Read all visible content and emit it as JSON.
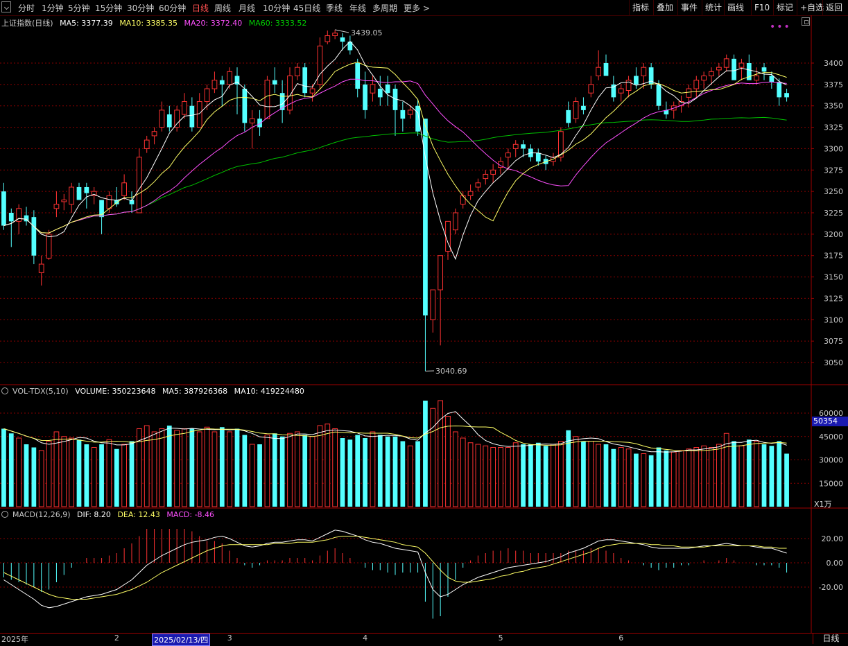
{
  "toolbar": {
    "tabs": [
      {
        "label": "分时",
        "active": false
      },
      {
        "label": "1分钟",
        "active": false
      },
      {
        "label": "5分钟",
        "active": false
      },
      {
        "label": "15分钟",
        "active": false
      },
      {
        "label": "30分钟",
        "active": false
      },
      {
        "label": "60分钟",
        "active": false
      },
      {
        "label": "日线",
        "active": true
      },
      {
        "label": "周线",
        "active": false
      },
      {
        "label": "月线",
        "active": false
      },
      {
        "label": "10分钟",
        "active": false
      },
      {
        "label": "45日线",
        "active": false
      },
      {
        "label": "季线",
        "active": false
      },
      {
        "label": "年线",
        "active": false
      },
      {
        "label": "多周期",
        "active": false
      },
      {
        "label": "更多 >",
        "active": false
      }
    ],
    "right_buttons": [
      "指标",
      "叠加",
      "事件",
      "统计",
      "画线",
      "F10",
      "标记",
      "+自选",
      "返回"
    ]
  },
  "price_panel": {
    "title": "上证指数(日线)",
    "ma5": "MA5: 3377.39",
    "ma10": "MA10: 3385.35",
    "ma20": "MA20: 3372.40",
    "ma60": "MA60: 3333.52",
    "max_label": "3439.05",
    "min_label": "3040.69",
    "axis_labels": [
      "3400",
      "3375",
      "3350",
      "3325",
      "3300",
      "3275",
      "3250",
      "3225",
      "3200",
      "3175",
      "3150",
      "3125",
      "3100",
      "3075",
      "3050"
    ]
  },
  "volume_panel": {
    "title": "VOL-TDX(5,10)",
    "volume": "VOLUME: 350223648",
    "ma5": "MA5: 387926368",
    "ma10": "MA10: 419224480",
    "axis_labels": [
      "60000",
      "45000",
      "30000",
      "15000"
    ],
    "current_value": "50354",
    "unit": "X1万"
  },
  "macd_panel": {
    "title": "MACD(12,26,9)",
    "dif": "DIF: 8.20",
    "dea": "DEA: 12.43",
    "macd": "MACD: -8.46",
    "axis_labels": [
      "20.00",
      "0.00",
      "-20.00"
    ]
  },
  "date_axis": {
    "labels": [
      {
        "text": "2025年",
        "idx": 0
      },
      {
        "text": "2",
        "idx": 15
      },
      {
        "text": "3",
        "idx": 30
      },
      {
        "text": "4",
        "idx": 48
      },
      {
        "text": "5",
        "idx": 66
      },
      {
        "text": "6",
        "idx": 82
      }
    ],
    "cursor_date": "2025/02/13/四",
    "cursor_idx": 20,
    "period": "日线"
  },
  "colors": {
    "up": "#ff3232",
    "down": "#54ffff",
    "ma5": "#ffffff",
    "ma10": "#ffff66",
    "ma20": "#ff50ff",
    "ma60": "#00c000",
    "grid": "#8a0000",
    "axis": "#a00000"
  },
  "chart_data": {
    "type": "candlestick",
    "title": "上证指数(日线)",
    "x_months": [
      "2025年",
      "2",
      "3",
      "4",
      "5",
      "6"
    ],
    "ohlc": [
      [
        3250,
        3260,
        3205,
        3210
      ],
      [
        3225,
        3230,
        3185,
        3215
      ],
      [
        3215,
        3235,
        3200,
        3230
      ],
      [
        3222,
        3232,
        3210,
        3215
      ],
      [
        3220,
        3228,
        3165,
        3175
      ],
      [
        3155,
        3175,
        3140,
        3165
      ],
      [
        3172,
        3205,
        3170,
        3200
      ],
      [
        3230,
        3250,
        3220,
        3235
      ],
      [
        3238,
        3247,
        3228,
        3240
      ],
      [
        3235,
        3260,
        3225,
        3255
      ],
      [
        3255,
        3260,
        3245,
        3240
      ],
      [
        3255,
        3260,
        3230,
        3248
      ],
      [
        3245,
        3255,
        3235,
        3250
      ],
      [
        3240,
        3235,
        3200,
        3220
      ],
      [
        3230,
        3250,
        3225,
        3245
      ],
      [
        3240,
        3255,
        3232,
        3235
      ],
      [
        3245,
        3270,
        3240,
        3260
      ],
      [
        3240,
        3250,
        3225,
        3235
      ],
      [
        3225,
        3300,
        3225,
        3290
      ],
      [
        3300,
        3315,
        3295,
        3310
      ],
      [
        3315,
        3325,
        3305,
        3320
      ],
      [
        3325,
        3355,
        3320,
        3345
      ],
      [
        3340,
        3350,
        3320,
        3325
      ],
      [
        3325,
        3350,
        3320,
        3345
      ],
      [
        3340,
        3365,
        3335,
        3355
      ],
      [
        3350,
        3360,
        3320,
        3325
      ],
      [
        3325,
        3365,
        3325,
        3355
      ],
      [
        3355,
        3375,
        3345,
        3370
      ],
      [
        3370,
        3390,
        3365,
        3380
      ],
      [
        3380,
        3385,
        3350,
        3375
      ],
      [
        3375,
        3395,
        3370,
        3390
      ],
      [
        3385,
        3395,
        3340,
        3375
      ],
      [
        3370,
        3375,
        3320,
        3330
      ],
      [
        3330,
        3345,
        3300,
        3335
      ],
      [
        3335,
        3345,
        3315,
        3325
      ],
      [
        3335,
        3385,
        3335,
        3380
      ],
      [
        3380,
        3395,
        3365,
        3375
      ],
      [
        3365,
        3380,
        3330,
        3345
      ],
      [
        3345,
        3395,
        3340,
        3385
      ],
      [
        3385,
        3400,
        3380,
        3395
      ],
      [
        3395,
        3400,
        3360,
        3365
      ],
      [
        3365,
        3375,
        3355,
        3370
      ],
      [
        3375,
        3430,
        3370,
        3420
      ],
      [
        3425,
        3438,
        3422,
        3432
      ],
      [
        3432,
        3439,
        3428,
        3435
      ],
      [
        3430,
        3435,
        3415,
        3425
      ],
      [
        3425,
        3432,
        3410,
        3415
      ],
      [
        3400,
        3405,
        3360,
        3370
      ],
      [
        3375,
        3390,
        3335,
        3345
      ],
      [
        3365,
        3385,
        3355,
        3375
      ],
      [
        3370,
        3385,
        3350,
        3360
      ],
      [
        3375,
        3385,
        3350,
        3365
      ],
      [
        3370,
        3375,
        3315,
        3345
      ],
      [
        3345,
        3355,
        3320,
        3335
      ],
      [
        3340,
        3350,
        3335,
        3345
      ],
      [
        3350,
        3358,
        3315,
        3320
      ],
      [
        3335,
        3320,
        3040,
        3105
      ],
      [
        3100,
        3130,
        3085,
        3135
      ],
      [
        3135,
        3160,
        3070,
        3175
      ],
      [
        3180,
        3215,
        3170,
        3215
      ],
      [
        3205,
        3230,
        3200,
        3225
      ],
      [
        3235,
        3250,
        3230,
        3245
      ],
      [
        3245,
        3258,
        3240,
        3250
      ],
      [
        3255,
        3265,
        3250,
        3260
      ],
      [
        3265,
        3275,
        3258,
        3270
      ],
      [
        3270,
        3282,
        3260,
        3275
      ],
      [
        3278,
        3290,
        3270,
        3285
      ],
      [
        3290,
        3300,
        3275,
        3295
      ],
      [
        3300,
        3310,
        3290,
        3305
      ],
      [
        3305,
        3310,
        3290,
        3300
      ],
      [
        3300,
        3305,
        3285,
        3290
      ],
      [
        3295,
        3300,
        3280,
        3285
      ],
      [
        3288,
        3292,
        3275,
        3282
      ],
      [
        3285,
        3295,
        3280,
        3290
      ],
      [
        3290,
        3325,
        3285,
        3320
      ],
      [
        3345,
        3355,
        3325,
        3330
      ],
      [
        3335,
        3360,
        3330,
        3355
      ],
      [
        3350,
        3360,
        3340,
        3345
      ],
      [
        3365,
        3385,
        3360,
        3375
      ],
      [
        3385,
        3415,
        3380,
        3395
      ],
      [
        3400,
        3410,
        3385,
        3385
      ],
      [
        3375,
        3385,
        3355,
        3360
      ],
      [
        3365,
        3375,
        3355,
        3370
      ],
      [
        3368,
        3385,
        3360,
        3380
      ],
      [
        3385,
        3395,
        3370,
        3375
      ],
      [
        3385,
        3400,
        3370,
        3395
      ],
      [
        3395,
        3400,
        3370,
        3375
      ],
      [
        3375,
        3380,
        3345,
        3350
      ],
      [
        3345,
        3355,
        3335,
        3340
      ],
      [
        3345,
        3355,
        3335,
        3350
      ],
      [
        3350,
        3362,
        3342,
        3355
      ],
      [
        3360,
        3375,
        3348,
        3370
      ],
      [
        3370,
        3385,
        3360,
        3380
      ],
      [
        3380,
        3390,
        3370,
        3385
      ],
      [
        3385,
        3395,
        3375,
        3390
      ],
      [
        3392,
        3400,
        3385,
        3395
      ],
      [
        3395,
        3410,
        3390,
        3405
      ],
      [
        3405,
        3410,
        3385,
        3380
      ],
      [
        3395,
        3405,
        3380,
        3400
      ],
      [
        3400,
        3410,
        3385,
        3380
      ],
      [
        3380,
        3395,
        3375,
        3385
      ],
      [
        3395,
        3400,
        3380,
        3390
      ],
      [
        3385,
        3390,
        3370,
        3378
      ],
      [
        3378,
        3382,
        3350,
        3360
      ],
      [
        3365,
        3370,
        3355,
        3360
      ]
    ],
    "volume_10k": [
      50000,
      47000,
      44000,
      40000,
      38000,
      36000,
      42000,
      48000,
      45000,
      44000,
      43000,
      40000,
      38000,
      40000,
      43000,
      37000,
      40000,
      42000,
      50000,
      52000,
      48000,
      50000,
      52000,
      49000,
      50000,
      50000,
      48000,
      51000,
      48000,
      51000,
      48000,
      50000,
      46000,
      40000,
      40000,
      46000,
      47000,
      45000,
      47000,
      48000,
      46000,
      45000,
      52000,
      53000,
      50000,
      44000,
      43000,
      46000,
      44000,
      48000,
      46000,
      45000,
      45000,
      42000,
      39000,
      42000,
      68000,
      63000,
      68000,
      58000,
      48000,
      44000,
      41000,
      40000,
      39000,
      38000,
      38000,
      38000,
      41000,
      40000,
      40000,
      41000,
      39000,
      40000,
      42000,
      49000,
      45000,
      42000,
      42000,
      40000,
      40000,
      37000,
      38000,
      37000,
      34000,
      34000,
      33000,
      38000,
      36000,
      35000,
      36000,
      37000,
      38000,
      39000,
      38000,
      40000,
      47000,
      42000,
      39000,
      43000,
      42000,
      40000,
      39000,
      42000,
      34000
    ],
    "dif": [
      -14,
      -18,
      -22,
      -26,
      -30,
      -35,
      -37,
      -36,
      -34,
      -32,
      -30,
      -28,
      -27,
      -26,
      -24,
      -22,
      -18,
      -14,
      -8,
      -2,
      2,
      6,
      9,
      12,
      15,
      17,
      18,
      19,
      21,
      22,
      20,
      17,
      14,
      13,
      14,
      16,
      17,
      17,
      18,
      19,
      19,
      18,
      21,
      24,
      27,
      26,
      24,
      22,
      19,
      17,
      16,
      14,
      12,
      11,
      10,
      9,
      -8,
      -22,
      -28,
      -26,
      -22,
      -18,
      -15,
      -12,
      -10,
      -8,
      -6,
      -4,
      -3,
      -2,
      -1,
      0,
      1,
      3,
      5,
      8,
      10,
      12,
      15,
      18,
      19,
      19,
      18,
      17,
      16,
      15,
      13,
      12,
      12,
      12,
      12,
      12,
      13,
      14,
      14,
      15,
      16,
      15,
      14,
      14,
      13,
      12,
      12,
      10,
      8
    ],
    "dea": [
      -8,
      -11,
      -14,
      -17,
      -20,
      -23,
      -26,
      -28,
      -29,
      -30,
      -30,
      -30,
      -29,
      -28,
      -27,
      -26,
      -24,
      -22,
      -19,
      -16,
      -12,
      -8,
      -5,
      -2,
      1,
      4,
      7,
      10,
      12,
      14,
      15,
      15,
      15,
      15,
      15,
      15,
      16,
      16,
      16,
      17,
      17,
      17,
      18,
      19,
      21,
      22,
      22,
      22,
      21,
      20,
      19,
      18,
      17,
      15,
      14,
      13,
      8,
      1,
      -6,
      -12,
      -15,
      -16,
      -16,
      -15,
      -14,
      -13,
      -11,
      -10,
      -8,
      -7,
      -5,
      -4,
      -3,
      -1,
      1,
      3,
      5,
      7,
      9,
      12,
      14,
      15,
      16,
      16,
      16,
      16,
      15,
      15,
      14,
      14,
      13,
      13,
      13,
      13,
      14,
      14,
      14,
      14,
      14,
      14,
      14,
      13,
      13,
      12,
      12
    ]
  }
}
